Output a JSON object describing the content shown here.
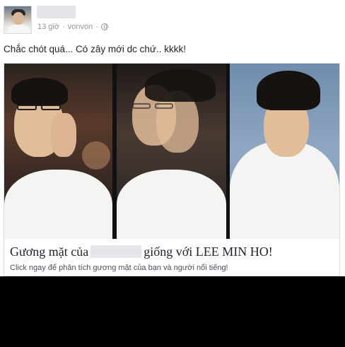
{
  "post": {
    "meta": {
      "time": "13 giờ",
      "separator": "·",
      "via": "vonvon",
      "separator2": "·",
      "privacy_icon": "globe-icon"
    },
    "status_text": "Chắc chót quá... Có zây mới dc chứ.. kkkk!"
  },
  "link_card": {
    "title_before": "Gương mặt của",
    "title_after": "giống với LEE MIN HO!",
    "description": "Click ngay để phân tích gương mặt của bạn và người nổi tiếng!"
  },
  "colors": {
    "meta_text": "#90949c",
    "body_text": "#1d2129",
    "redaction": "#e4e6eb",
    "card_border": "#d8dbe1"
  }
}
